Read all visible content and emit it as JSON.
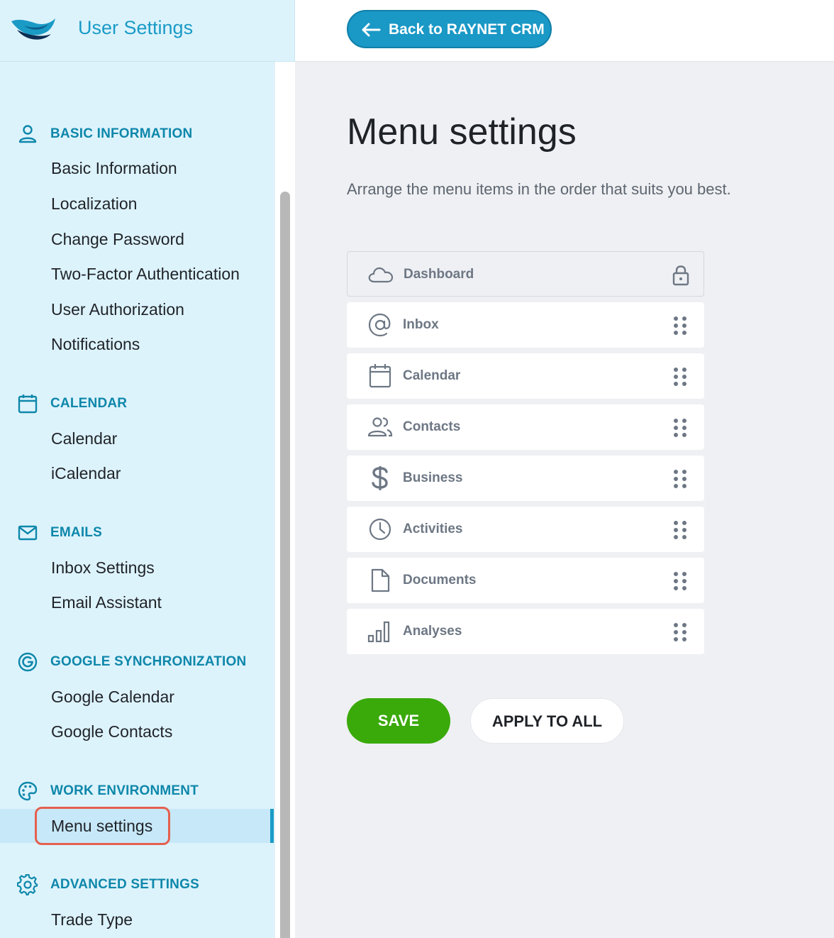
{
  "app": {
    "title": "User Settings"
  },
  "topbar": {
    "back_label": "Back to RAYNET CRM"
  },
  "sidebar": {
    "sections": [
      {
        "title": "BASIC INFORMATION",
        "icon": "user-icon",
        "items": [
          "Basic Information",
          "Localization",
          "Change Password",
          "Two-Factor Authentication",
          "User Authorization",
          "Notifications"
        ]
      },
      {
        "title": "CALENDAR",
        "icon": "calendar-icon",
        "items": [
          "Calendar",
          "iCalendar"
        ]
      },
      {
        "title": "EMAILS",
        "icon": "envelope-icon",
        "items": [
          "Inbox Settings",
          "Email Assistant"
        ]
      },
      {
        "title": "GOOGLE SYNCHRONIZATION",
        "icon": "google-icon",
        "items": [
          "Google Calendar",
          "Google Contacts"
        ]
      },
      {
        "title": "WORK ENVIRONMENT",
        "icon": "palette-icon",
        "items": [
          "Menu settings"
        ],
        "active_item": "Menu settings"
      },
      {
        "title": "ADVANCED SETTINGS",
        "icon": "gear-icon",
        "items": [
          "Trade Type"
        ]
      }
    ]
  },
  "main": {
    "title": "Menu settings",
    "description": "Arrange the menu items in the order that suits you best.",
    "menu_items": [
      {
        "label": "Dashboard",
        "icon": "cloud-icon",
        "locked": true
      },
      {
        "label": "Inbox",
        "icon": "at-icon",
        "locked": false
      },
      {
        "label": "Calendar",
        "icon": "calendar-icon",
        "locked": false
      },
      {
        "label": "Contacts",
        "icon": "people-icon",
        "locked": false
      },
      {
        "label": "Business",
        "icon": "dollar-icon",
        "locked": false
      },
      {
        "label": "Activities",
        "icon": "clock-icon",
        "locked": false
      },
      {
        "label": "Documents",
        "icon": "document-icon",
        "locked": false
      },
      {
        "label": "Analyses",
        "icon": "bar-chart-icon",
        "locked": false
      }
    ],
    "save_label": "SAVE",
    "apply_all_label": "APPLY TO ALL"
  },
  "colors": {
    "accent": "#1a9bc6",
    "save_green": "#3aa90a",
    "highlight": "#e4604f",
    "sidebar_bg": "#ddf3fc"
  }
}
